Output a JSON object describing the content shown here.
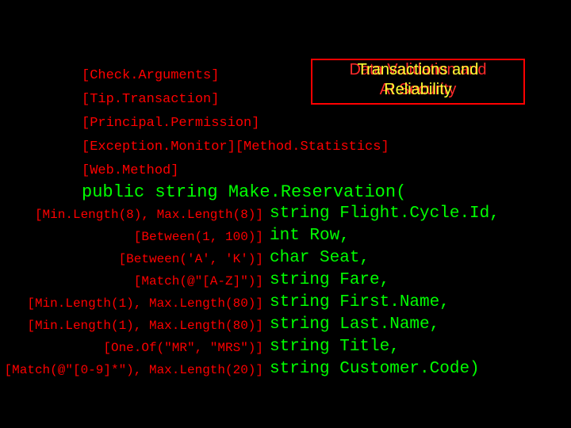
{
  "title": {
    "red_line1": "Data Validation and",
    "red_line2": "AI Security",
    "yellow_line1": "Transactions and",
    "yellow_line2": "Reliability"
  },
  "method_attrs": [
    "[Check.Arguments]",
    "[Tip.Transaction]",
    "[Principal.Permission]",
    "[Exception.Monitor][Method.Statistics]",
    "[Web.Method]"
  ],
  "signature": "public string Make.Reservation(",
  "params": [
    {
      "attr": "[Min.Length(8), Max.Length(8)]",
      "code": "string Flight.Cycle.Id,"
    },
    {
      "attr": "[Between(1, 100)]",
      "code": "int Row,"
    },
    {
      "attr": "[Between('A', 'K')]",
      "code": "char Seat,"
    },
    {
      "attr": "[Match(@\"[A-Z]\")]",
      "code": "string Fare,"
    },
    {
      "attr": "[Min.Length(1), Max.Length(80)]",
      "code": "string First.Name,"
    },
    {
      "attr": "[Min.Length(1), Max.Length(80)]",
      "code": "string Last.Name,"
    },
    {
      "attr": "[One.Of(\"MR\", \"MRS\")]",
      "code": "string Title,"
    },
    {
      "attr": "[Match(@\"[0-9]*\"), Max.Length(20)]",
      "code": "string Customer.Code)"
    }
  ]
}
